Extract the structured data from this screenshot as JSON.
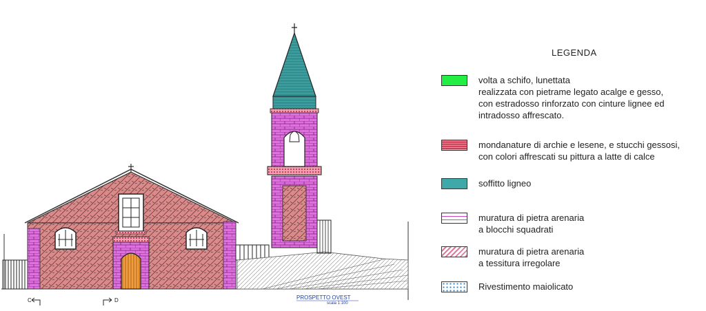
{
  "legend": {
    "title": "LEGENDA",
    "items": [
      {
        "key": "volta",
        "color": "#22ee44",
        "pattern": "solid",
        "lines": [
          "volta a schifo, lunettata",
          "realizzata con pietrame legato acalge e gesso,",
          "con estradosso rinforzato con cinture lignee ed",
          "intradosso affrescato."
        ]
      },
      {
        "key": "mondanature",
        "color": "#e0607a",
        "pattern": "dense",
        "lines": [
          "mondanature di archie e lesene, e stucchi gessosi,",
          "con colori  affrescati su pittura  a latte di calce"
        ]
      },
      {
        "key": "soffitto",
        "color": "#3fa8a8",
        "pattern": "solid-hatch",
        "lines": [
          "soffitto ligneo"
        ]
      },
      {
        "key": "blocchi",
        "color": "#cc44cc",
        "pattern": "bricks",
        "lines": [
          "muratura  di pietra arenaria",
          "a blocchi squadrati"
        ]
      },
      {
        "key": "irregolare",
        "color": "#e07a9a",
        "pattern": "diagonal",
        "lines": [
          "muratura  di pietra arenaria",
          "a tessitura irregolare"
        ]
      },
      {
        "key": "maiolica",
        "color": "#3388cc",
        "pattern": "dots",
        "lines": [
          "Rivestimento maiolicato"
        ]
      }
    ]
  },
  "drawing": {
    "title": "PROSPETTO OVEST",
    "scale": "scala 1:100",
    "section_c": "C",
    "section_d": "D"
  }
}
